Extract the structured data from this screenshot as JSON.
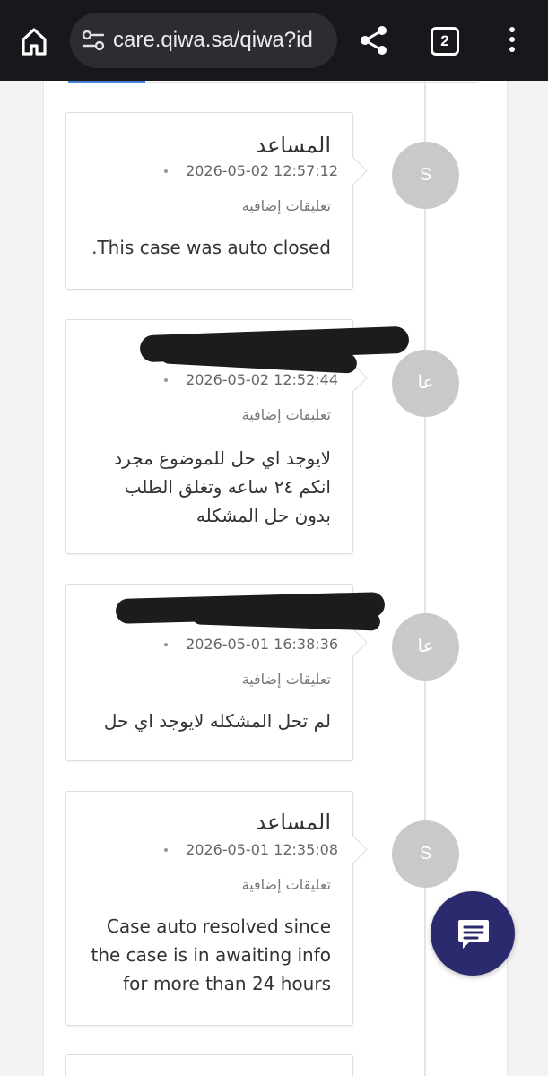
{
  "browser": {
    "url": "care.qiwa.sa/qiwa?id",
    "tab_count": "2"
  },
  "timeline": [
    {
      "author": "المساعد",
      "author_redacted": false,
      "avatar_initial": "S",
      "timestamp": "2026-05-02 12:57:12",
      "comment_type": "تعليقات إضافية",
      "body": ".This case was auto closed",
      "body_dir": "ltr"
    },
    {
      "author": "",
      "author_redacted": true,
      "avatar_initial": "عا",
      "timestamp": "2026-05-02 12:52:44",
      "comment_type": "تعليقات إضافية",
      "body": "لايوجد اي حل للموضوع مجرد\nانكم ٢٤ ساعه وتغلق الطلب\nبدون حل المشكله",
      "body_dir": "rtl"
    },
    {
      "author": "",
      "author_redacted": true,
      "avatar_initial": "عا",
      "timestamp": "2026-05-01 16:38:36",
      "comment_type": "تعليقات إضافية",
      "body": "لم تحل المشكله لايوجد اي حل",
      "body_dir": "rtl"
    },
    {
      "author": "المساعد",
      "author_redacted": false,
      "avatar_initial": "S",
      "timestamp": "2026-05-01 12:35:08",
      "comment_type": "تعليقات إضافية",
      "body": "Case auto resolved since\nthe case is in awaiting info\nfor more than 24 hours",
      "body_dir": "ltr"
    }
  ],
  "icons": {
    "home": "home-icon",
    "site_settings": "tune-icon",
    "share": "share-icon",
    "tabs": "tab-switcher-icon",
    "menu": "more-vert-icon",
    "chat": "chat-bubble-icon"
  },
  "colors": {
    "toolbar": "#16181c",
    "url_pill": "#2b2d31",
    "avatar": "#c9c9c9",
    "chat_fab": "#2c2a6e",
    "accent_blue": "#4a7fd9"
  }
}
